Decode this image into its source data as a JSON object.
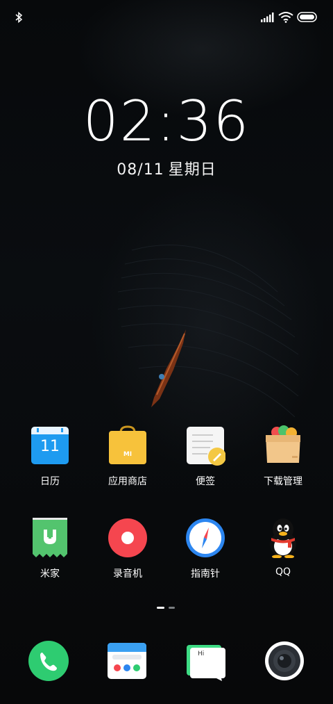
{
  "status_bar": {
    "bluetooth_icon": "bluetooth-icon",
    "signal_icon": "signal-icon",
    "wifi_icon": "wifi-icon",
    "battery_icon": "battery-icon"
  },
  "lockscreen": {
    "time": "02:36",
    "date": "08/11",
    "weekday": "星期日"
  },
  "apps_row1": [
    {
      "label": "日历",
      "icon": "calendar-icon",
      "badge": "11"
    },
    {
      "label": "应用商店",
      "icon": "app-store-icon",
      "badge": "MI"
    },
    {
      "label": "便签",
      "icon": "notes-icon"
    },
    {
      "label": "下载管理",
      "icon": "downloads-icon"
    }
  ],
  "apps_row2": [
    {
      "label": "米家",
      "icon": "mijia-icon"
    },
    {
      "label": "录音机",
      "icon": "recorder-icon"
    },
    {
      "label": "指南针",
      "icon": "compass-icon"
    },
    {
      "label": "QQ",
      "icon": "qq-icon"
    }
  ],
  "pager": {
    "pages": 2,
    "current": 1
  },
  "dock": [
    {
      "icon": "phone-icon"
    },
    {
      "icon": "browser-icon"
    },
    {
      "icon": "messages-icon",
      "text": "Hi"
    },
    {
      "icon": "camera-icon"
    }
  ],
  "colors": {
    "calendar_blue": "#1e9bf0",
    "store_yellow": "#f7c23b",
    "recorder_red": "#f5464f",
    "compass_blue": "#2c86f0",
    "phone_green": "#2ecc71",
    "mijia_green": "#53c46e"
  }
}
